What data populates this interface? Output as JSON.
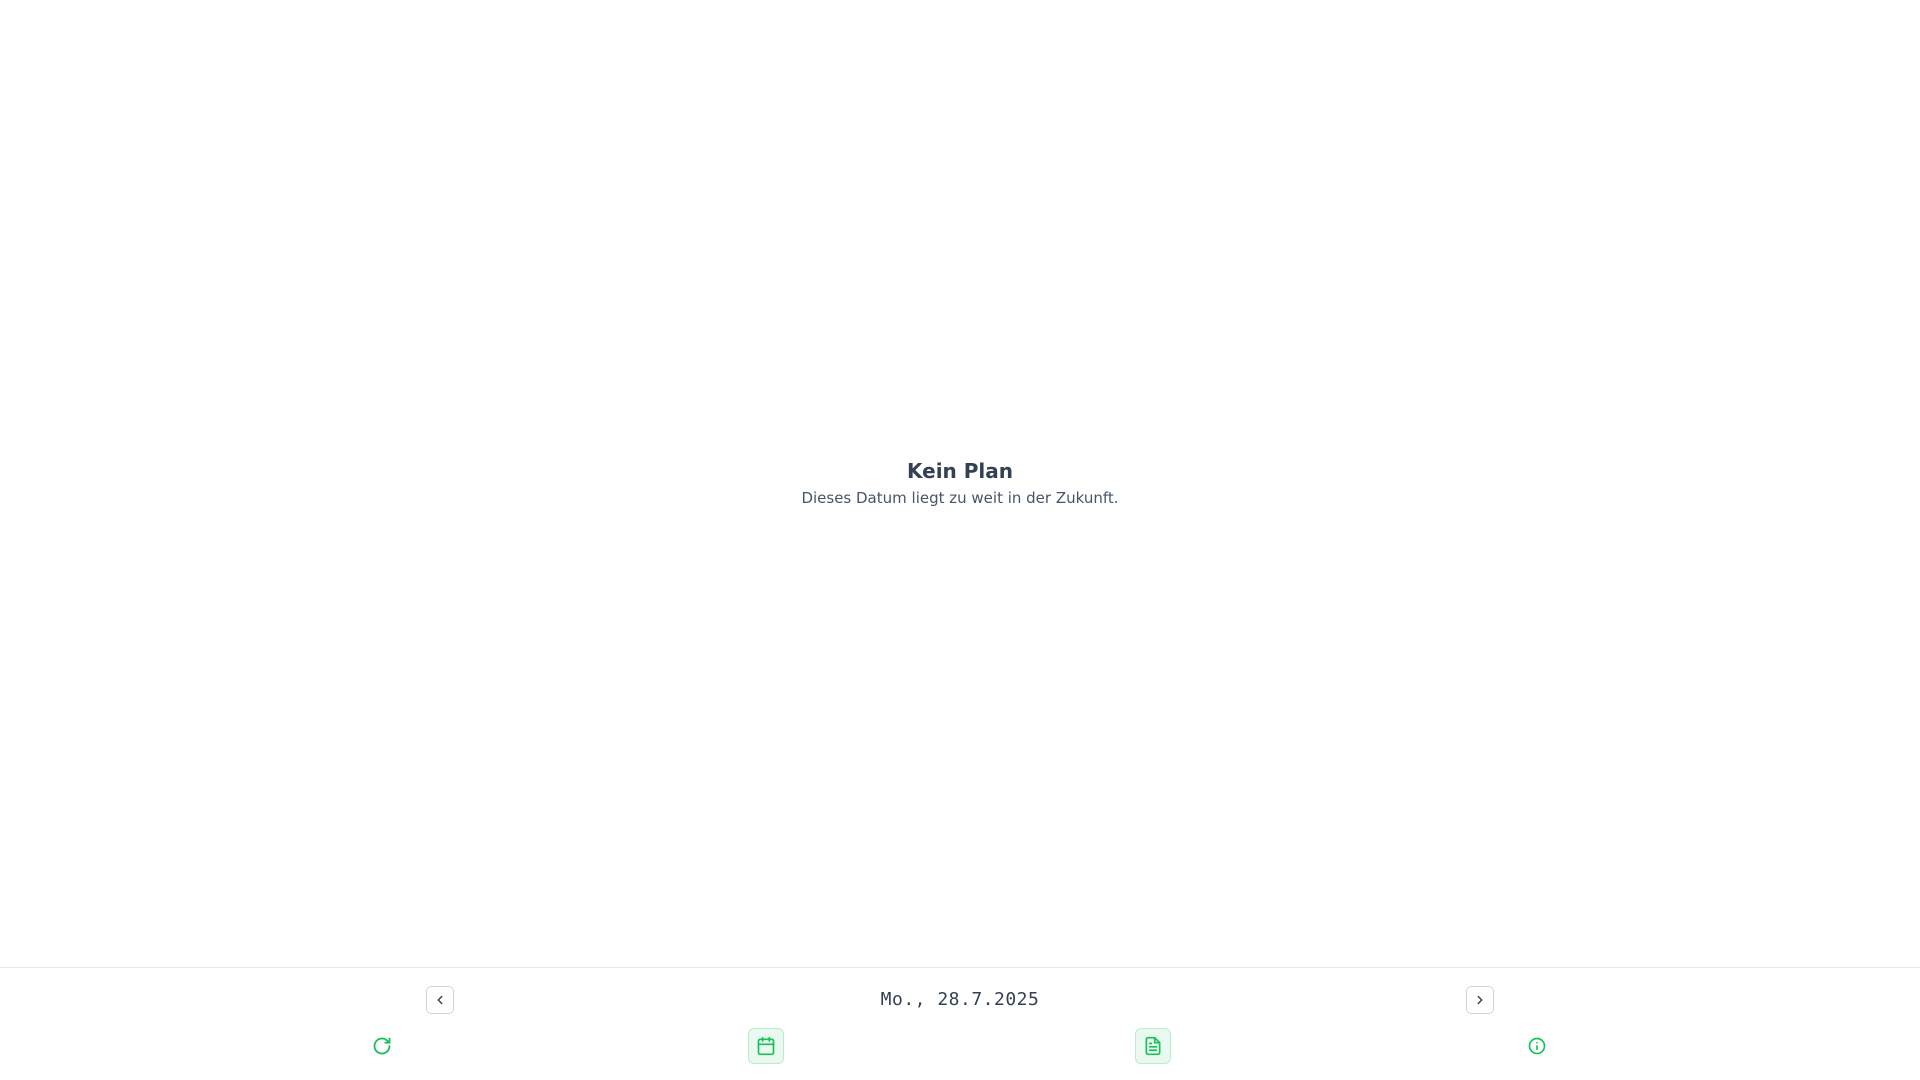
{
  "empty_state": {
    "title": "Kein Plan",
    "message": "Dieses Datum liegt zu weit in der Zukunft."
  },
  "date_nav": {
    "date_text": "Mo., 28.7.2025",
    "prev_icon": "chevron-left-icon",
    "next_icon": "chevron-right-icon"
  },
  "actions": [
    {
      "icon": "refresh-icon"
    },
    {
      "icon": "calendar-icon"
    },
    {
      "icon": "document-icon"
    },
    {
      "icon": "info-icon"
    }
  ],
  "colors": {
    "accent": "#16c15a",
    "text": "#334155",
    "border": "#cbd5e1"
  }
}
